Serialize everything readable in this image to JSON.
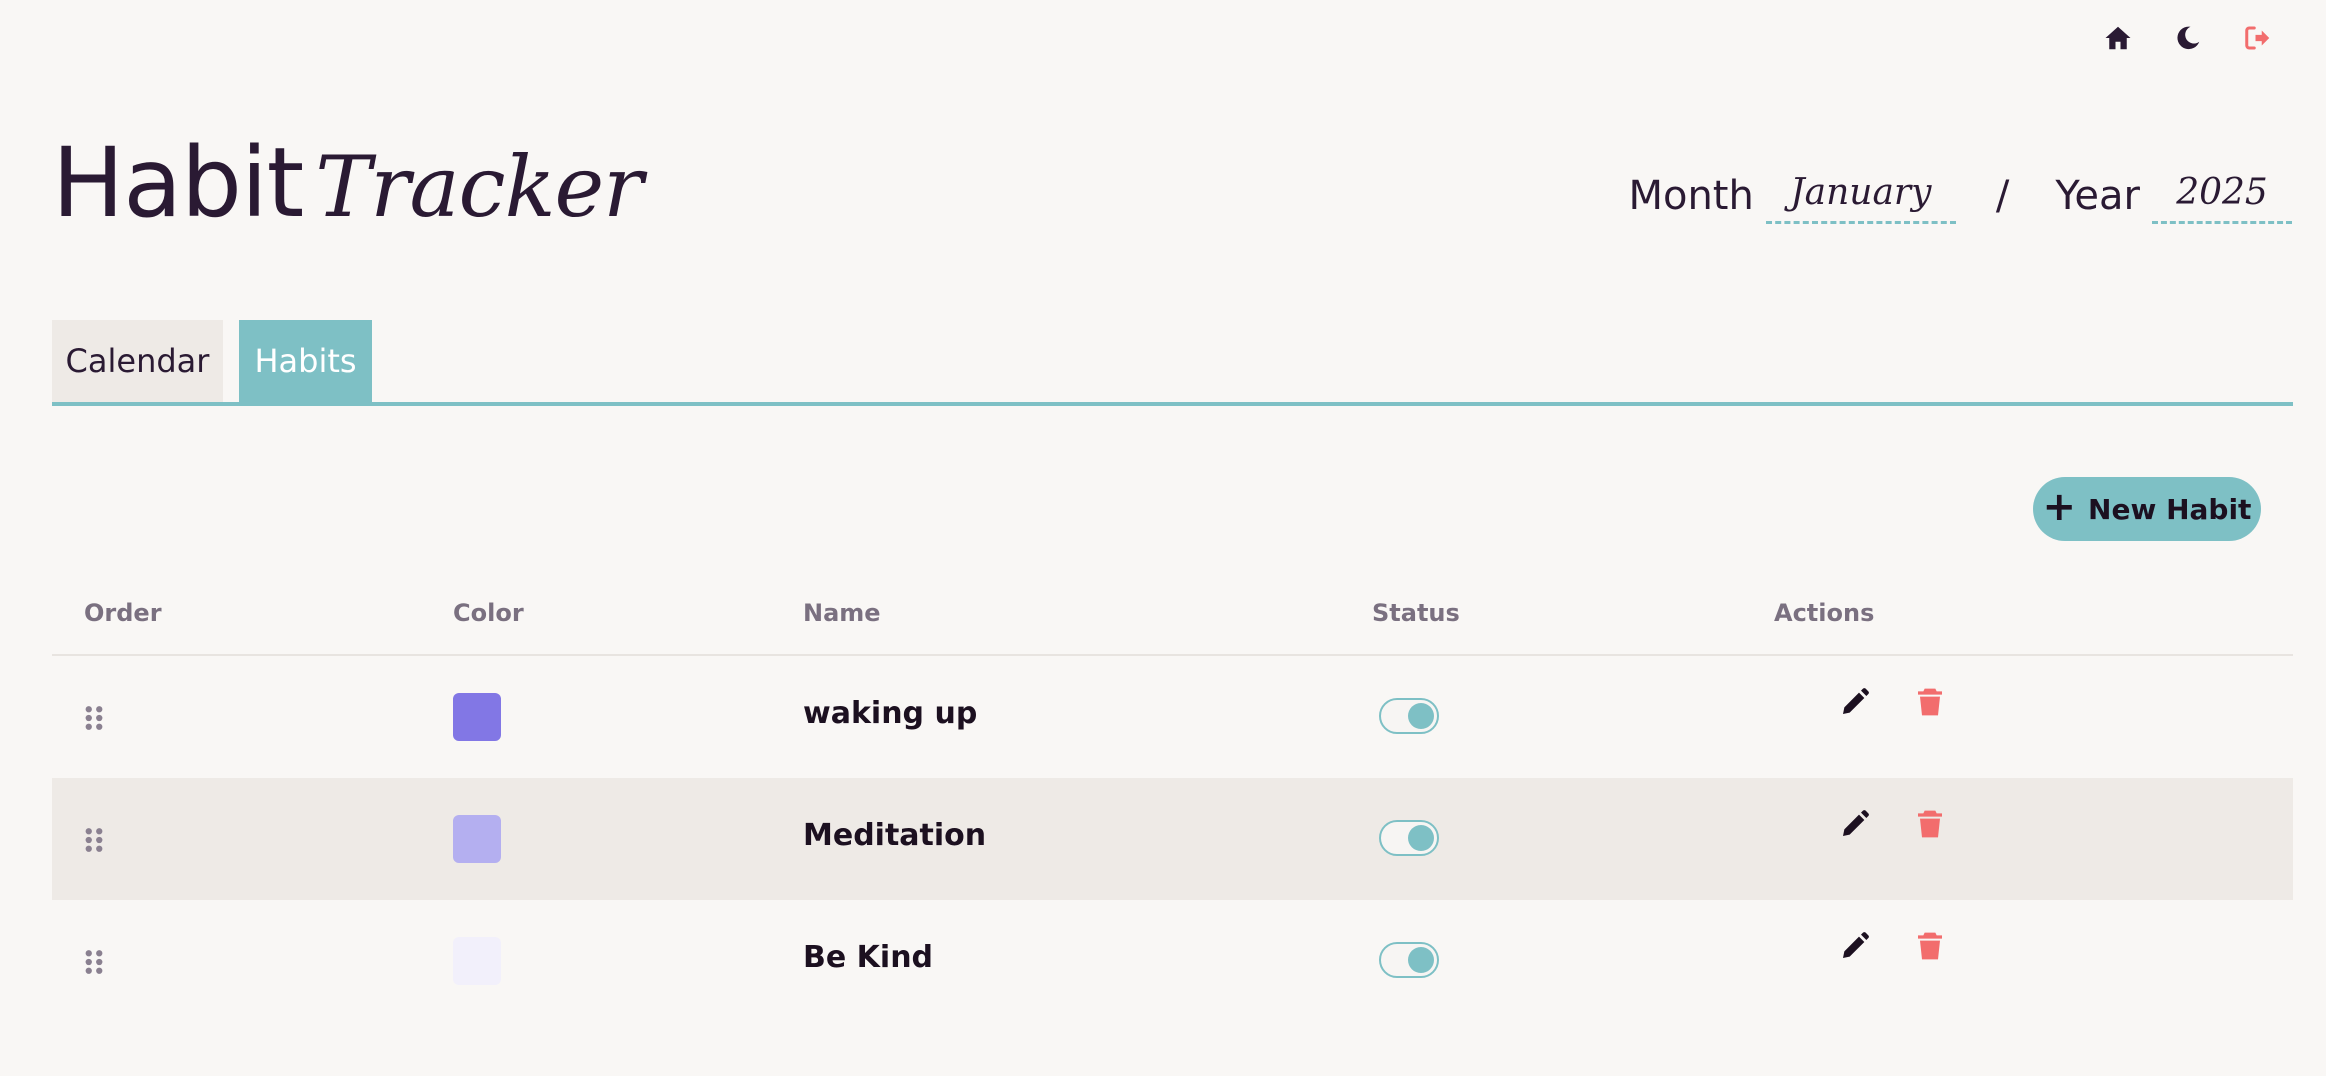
{
  "topbar": {
    "icons": [
      "home-icon",
      "moon-icon",
      "logout-icon"
    ],
    "logout_color": "#f26d6d"
  },
  "title": {
    "plain": "Habit",
    "script": "Tracker"
  },
  "period": {
    "month_label": "Month",
    "month_value": "January",
    "separator": "/",
    "year_label": "Year",
    "year_value": "2025"
  },
  "tabs": [
    {
      "label": "Calendar",
      "active": false
    },
    {
      "label": "Habits",
      "active": true
    }
  ],
  "new_habit_label": "New Habit",
  "table": {
    "headers": [
      "Order",
      "Color",
      "Name",
      "Status",
      "Actions"
    ],
    "rows": [
      {
        "color": "#8277e5",
        "name": "waking up",
        "status_on": true
      },
      {
        "color": "#b4aff0",
        "name": "Meditation",
        "status_on": true
      },
      {
        "color": "#f2f0fb",
        "name": "Be Kind",
        "status_on": true
      }
    ]
  },
  "colors": {
    "accent": "#7ec0c5",
    "danger": "#f26d6d",
    "text": "#2a1a33"
  }
}
